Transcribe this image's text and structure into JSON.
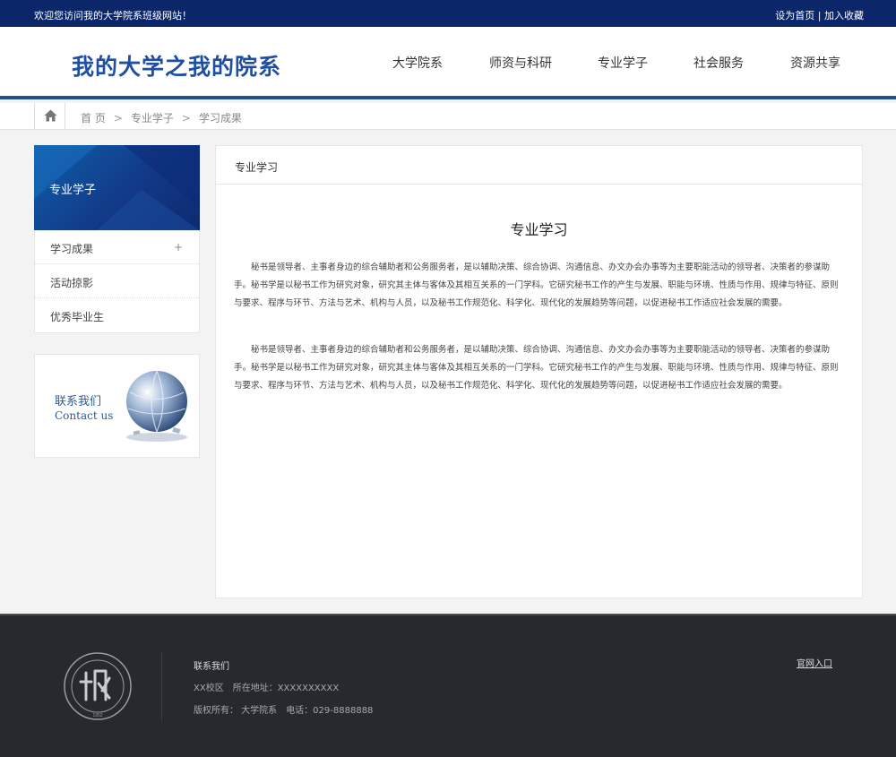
{
  "topbar": {
    "welcome": "欢迎您访问我的大学院系班级网站！",
    "set_home": "设为首页",
    "separator": "|",
    "add_favorite": "加入收藏"
  },
  "header": {
    "logo": "我的大学之我的院系",
    "nav": [
      "大学院系",
      "师资与科研",
      "专业学子",
      "社会服务",
      "资源共享"
    ]
  },
  "breadcrumb": {
    "home": "首 页",
    "sep": ">",
    "level1": "专业学子",
    "level2": "学习成果"
  },
  "sidebar": {
    "title": "专业学子",
    "items": [
      {
        "label": "学习成果",
        "marker": "+"
      },
      {
        "label": "活动掠影"
      },
      {
        "label": "优秀毕业生"
      }
    ],
    "contact_cn": "联系我们",
    "contact_en": "Contact us"
  },
  "content": {
    "section_label": "专业学习",
    "title": "专业学习",
    "paragraphs": [
      "秘书是领导者、主事者身边的综合辅助者和公务服务者，是以辅助决策、综合协调、沟通信息、办文办会办事等为主要职能活动的领导者、决策者的参谋助手。秘书学是以秘书工作为研究对象，研究其主体与客体及其相互关系的一门学科。它研究秘书工作的产生与发展、职能与环境、性质与作用、规律与特征、原则与要求、程序与环节、方法与艺术、机构与人员，以及秘书工作规范化、科学化、现代化的发展趋势等问题，以促进秘书工作适应社会发展的需要。",
      "秘书是领导者、主事者身边的综合辅助者和公务服务者，是以辅助决策、综合协调、沟通信息、办文办会办事等为主要职能活动的领导者、决策者的参谋助手。秘书学是以秘书工作为研究对象，研究其主体与客体及其相互关系的一门学科。它研究秘书工作的产生与发展、职能与环境、性质与作用、规律与特征、原则与要求、程序与环节、方法与艺术、机构与人员，以及秘书工作规范化、科学化、现代化的发展趋势等问题，以促进秘书工作适应社会发展的需要。"
    ]
  },
  "footer": {
    "title": "联系我们",
    "campus": "XX校区",
    "address": "所在地址：XXXXXXXXXX",
    "copyright": "版权所有： 大学院系",
    "phone": "电话：029-8888888",
    "official_link": "官网入口",
    "seal_year": "1952"
  },
  "colors": {
    "topbar_bg": "#0b2769",
    "brand_blue": "#1f4fa3",
    "header_rule": "#1d4f93",
    "footer_bg": "#26292e"
  },
  "icons": {
    "home": "home-icon",
    "globe": "globe-puzzle-icon",
    "seal": "university-seal-logo"
  }
}
